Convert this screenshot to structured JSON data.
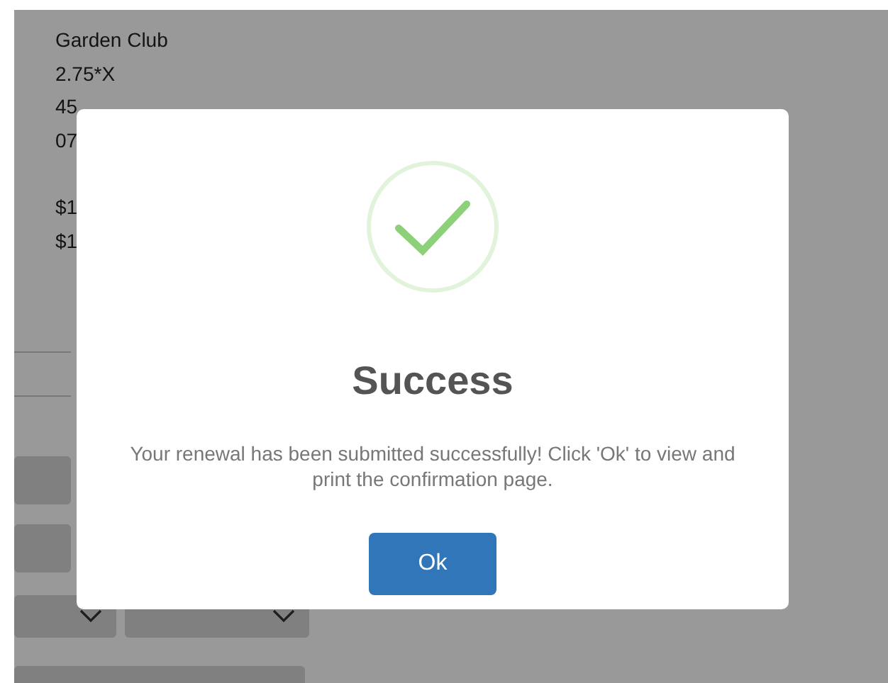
{
  "page": {
    "details": [
      "Garden Club",
      "2.75*X",
      "45",
      "07"
    ],
    "amounts": [
      "$1",
      "$1"
    ]
  },
  "dialog": {
    "title": "Success",
    "message": "Your renewal has been submitted successfully! Click 'Ok' to view and print the confirmation page.",
    "button": "Ok"
  }
}
